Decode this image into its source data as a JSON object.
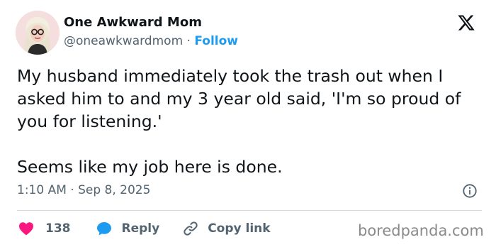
{
  "author": {
    "name": "One Awkward Mom",
    "handle": "@oneawkwardmom",
    "separator": "·",
    "follow_label": "Follow"
  },
  "tweet": {
    "paragraphs": [
      "My husband immediately took the trash out when I asked him to and my 3 year old said, 'I'm so proud of you for listening.'",
      "Seems like my job here is done."
    ],
    "timestamp": "1:10 AM · Sep 8, 2025"
  },
  "actions": {
    "like_count": "138",
    "reply_label": "Reply",
    "copy_link_label": "Copy link"
  },
  "watermark": "boredpanda.com",
  "icons": {
    "logo": "x-logo-icon",
    "info": "info-icon",
    "like": "heart-icon",
    "reply": "speech-bubble-icon",
    "copy": "link-icon"
  },
  "colors": {
    "text": "#0f1419",
    "secondary": "#536471",
    "follow": "#1d9bf0",
    "like": "#f91880",
    "reply": "#1d9bf0"
  }
}
